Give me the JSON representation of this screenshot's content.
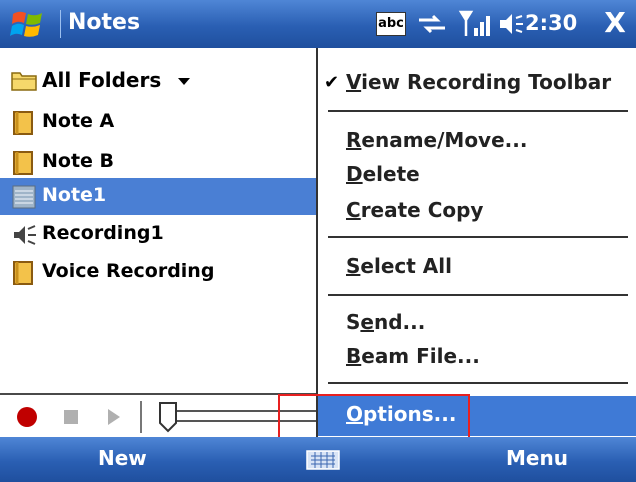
{
  "titlebar": {
    "app_title": "Notes",
    "abc_label": "abc",
    "clock": "2:30",
    "close_label": "X"
  },
  "folder": {
    "label": "All Folders"
  },
  "list": {
    "items": [
      {
        "label": "Note A",
        "icon": "note-icon"
      },
      {
        "label": "Note B",
        "icon": "note-icon"
      },
      {
        "label": "Note1",
        "icon": "note-icon"
      },
      {
        "label": "Recording1",
        "icon": "speaker-icon"
      },
      {
        "label": "Voice Recording",
        "icon": "note-icon"
      }
    ],
    "selected_index": 2
  },
  "menu": {
    "view_recording_toolbar": {
      "mnemonic": "V",
      "rest": "iew Recording Toolbar",
      "checked": true
    },
    "rename_move": {
      "mnemonic": "R",
      "rest": "ename/Move..."
    },
    "delete": {
      "mnemonic": "D",
      "rest": "elete"
    },
    "create_copy": {
      "mnemonic": "C",
      "rest": "reate Copy"
    },
    "select_all": {
      "mnemonic": "S",
      "rest": "elect All"
    },
    "send": {
      "pre": "S",
      "mnemonic": "e",
      "rest": "nd..."
    },
    "beam_file": {
      "mnemonic": "B",
      "rest": "eam File..."
    },
    "options": {
      "mnemonic": "O",
      "rest": "ptions..."
    },
    "check_mark": "✔"
  },
  "softkeys": {
    "left": "New",
    "right": "Menu"
  },
  "colors": {
    "bar_blue": "#2a5fb3",
    "selection": "#4a7fd4",
    "highlight_box": "#e82020"
  }
}
